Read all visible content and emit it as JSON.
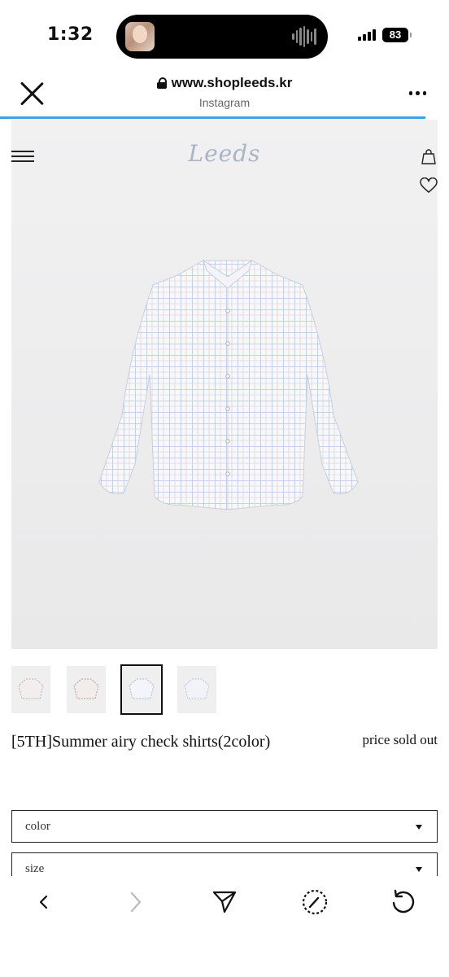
{
  "status": {
    "time": "1:32",
    "battery": "83"
  },
  "browser": {
    "url": "www.shopleeds.kr",
    "source": "Instagram"
  },
  "site": {
    "logo": "Leeds"
  },
  "product": {
    "name": "[5TH]Summer airy check shirts(2color)",
    "price": "price sold out",
    "options": [
      {
        "label": "color"
      },
      {
        "label": "size"
      }
    ],
    "selected_thumbnail": 3
  },
  "toolbar_icons": [
    "back-icon",
    "forward-icon",
    "share-send-icon",
    "speed-dial-icon",
    "reload-icon"
  ]
}
